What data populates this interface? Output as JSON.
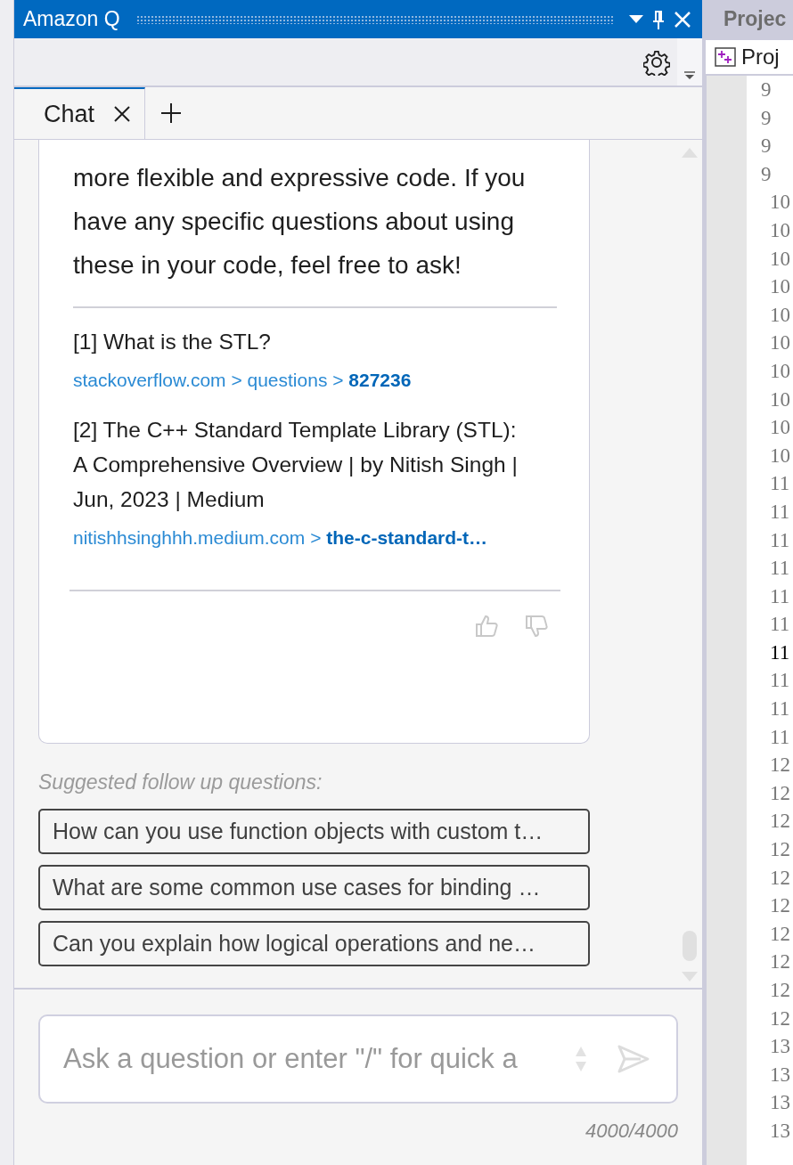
{
  "window": {
    "title": "Amazon Q"
  },
  "tabs": [
    {
      "label": "Chat",
      "selected": true
    }
  ],
  "message": {
    "text": "more flexible and expressive code. If you have any specific questions about using these in your code, feel free to ask!",
    "sources": [
      {
        "title": "[1] What is the STL?",
        "link_path": "stackoverflow.com > questions > ",
        "link_last": "827236"
      },
      {
        "title": "[2] The C++ Standard Template Library (STL): A Comprehensive Overview | by Nitish Singh | Jun, 2023 | Medium",
        "link_path": "nitishhsinghhh.medium.com > ",
        "link_last": "the-c-standard-t…"
      }
    ]
  },
  "suggestions": {
    "heading": "Suggested follow up questions:",
    "items": [
      "How can you use function objects with custom t…",
      "What are some common use cases for binding …",
      "Can you explain how logical operations and ne…"
    ]
  },
  "input": {
    "placeholder": "Ask a question or enter \"/\" for quick a",
    "counter": "4000/4000"
  },
  "side_panel": {
    "title": "Projec",
    "tab": "Proj",
    "line_numbers": [
      {
        "text": "9",
        "current": false
      },
      {
        "text": "9",
        "current": false
      },
      {
        "text": "9",
        "current": false
      },
      {
        "text": "9",
        "current": false
      },
      {
        "text": "10",
        "current": false
      },
      {
        "text": "10",
        "current": false
      },
      {
        "text": "10",
        "current": false
      },
      {
        "text": "10",
        "current": false
      },
      {
        "text": "10",
        "current": false
      },
      {
        "text": "10",
        "current": false
      },
      {
        "text": "10",
        "current": false
      },
      {
        "text": "10",
        "current": false
      },
      {
        "text": "10",
        "current": false
      },
      {
        "text": "10",
        "current": false
      },
      {
        "text": "11",
        "current": false
      },
      {
        "text": "11",
        "current": false
      },
      {
        "text": "11",
        "current": false
      },
      {
        "text": "11",
        "current": false
      },
      {
        "text": "11",
        "current": false
      },
      {
        "text": "11",
        "current": false
      },
      {
        "text": "11",
        "current": true
      },
      {
        "text": "11",
        "current": false
      },
      {
        "text": "11",
        "current": false
      },
      {
        "text": "11",
        "current": false
      },
      {
        "text": "12",
        "current": false
      },
      {
        "text": "12",
        "current": false
      },
      {
        "text": "12",
        "current": false
      },
      {
        "text": "12",
        "current": false
      },
      {
        "text": "12",
        "current": false
      },
      {
        "text": "12",
        "current": false
      },
      {
        "text": "12",
        "current": false
      },
      {
        "text": "12",
        "current": false
      },
      {
        "text": "12",
        "current": false
      },
      {
        "text": "12",
        "current": false
      },
      {
        "text": "13",
        "current": false
      },
      {
        "text": "13",
        "current": false
      },
      {
        "text": "13",
        "current": false
      },
      {
        "text": "13",
        "current": false
      }
    ]
  }
}
